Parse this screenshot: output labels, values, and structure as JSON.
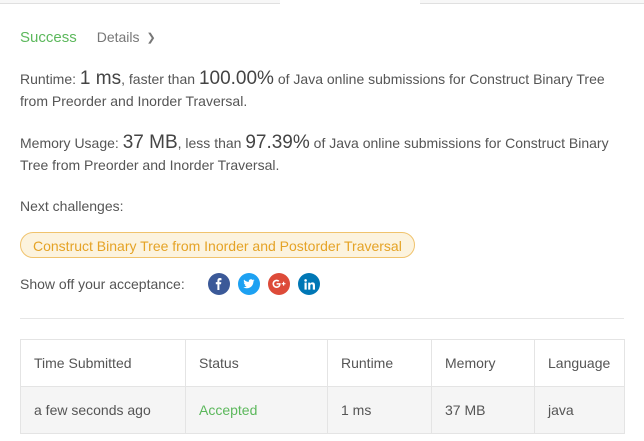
{
  "result": {
    "status": "Success",
    "details_label": "Details"
  },
  "runtime": {
    "prefix": "Runtime: ",
    "value": "1 ms",
    "middle": ", faster than ",
    "percent": "100.00%",
    "suffix": " of Java online submissions for Construct Binary Tree from Preorder and Inorder Traversal."
  },
  "memory": {
    "prefix": "Memory Usage: ",
    "value": "37 MB",
    "middle": ", less than ",
    "percent": "97.39%",
    "suffix": " of Java online submissions for Construct Binary Tree from Preorder and Inorder Traversal."
  },
  "next": {
    "label": "Next challenges:",
    "challenges": [
      "Construct Binary Tree from Inorder and Postorder Traversal"
    ]
  },
  "share": {
    "label": "Show off your acceptance:",
    "icons": [
      "facebook-icon",
      "twitter-icon",
      "google-plus-icon",
      "linkedin-icon"
    ]
  },
  "submissions": {
    "headers": [
      "Time Submitted",
      "Status",
      "Runtime",
      "Memory",
      "Language"
    ],
    "rows": [
      [
        "a few seconds ago",
        "Accepted",
        "1 ms",
        "37 MB",
        "java"
      ]
    ]
  },
  "colors": {
    "success": "#5cb85c",
    "challenge_text": "#e5a326",
    "challenge_bg": "#fcf3de"
  }
}
